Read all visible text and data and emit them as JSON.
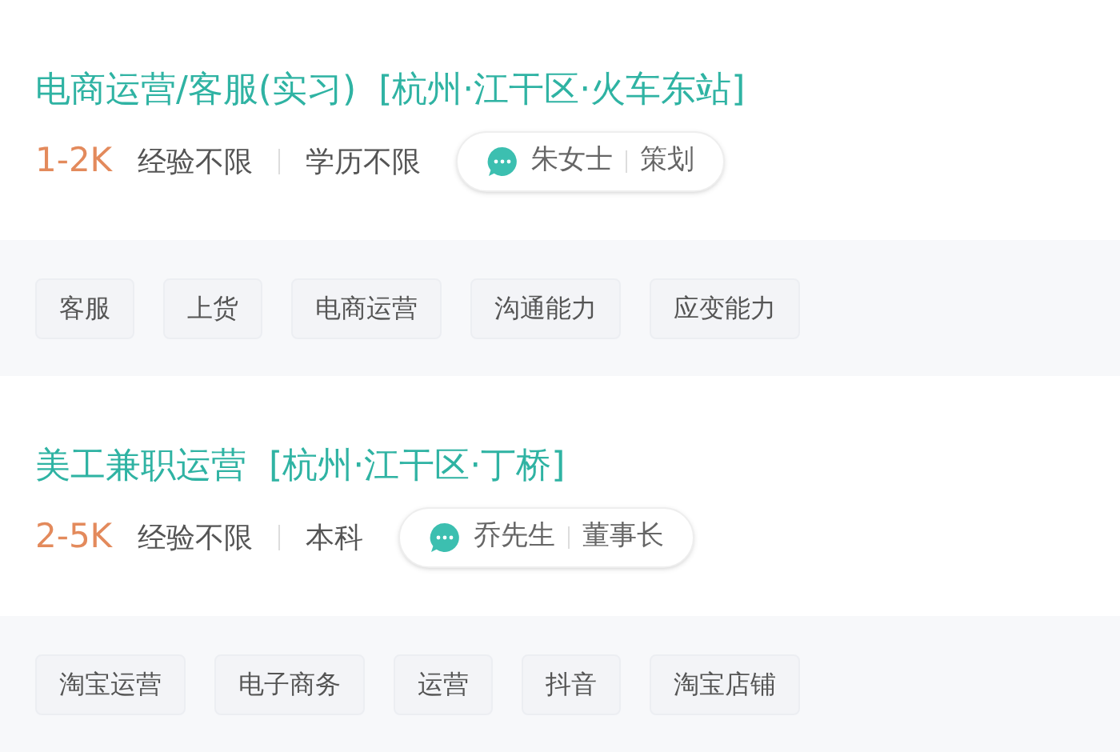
{
  "jobs": [
    {
      "title": "电商运营/客服(实习)",
      "location": "[杭州·江干区·火车东站]",
      "salary": "1-2K",
      "requirements": [
        "经验不限",
        "学历不限"
      ],
      "contact": {
        "name": "朱女士",
        "role": "策划"
      },
      "tags": [
        "客服",
        "上货",
        "电商运营",
        "沟通能力",
        "应变能力"
      ]
    },
    {
      "title": "美工兼职运营",
      "location": "[杭州·江干区·丁桥]",
      "salary": "2-5K",
      "requirements": [
        "经验不限",
        "本科"
      ],
      "contact": {
        "name": "乔先生",
        "role": "董事长"
      },
      "tags": [
        "淘宝运营",
        "电子商务",
        "运营",
        "抖音",
        "淘宝店铺"
      ]
    }
  ]
}
